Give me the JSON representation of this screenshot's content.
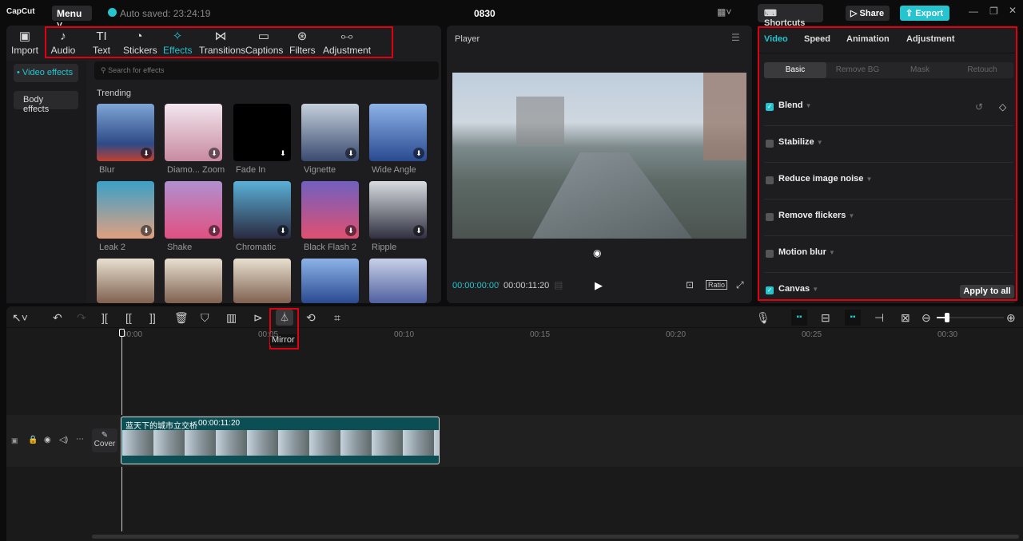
{
  "app": {
    "logo": "CapCut",
    "menu": "Menu",
    "autosave": "Auto saved: 23:24:19",
    "project": "0830",
    "shortcuts": "Shortcuts",
    "share": "Share",
    "export": "Export",
    "accent": "#25c4cf"
  },
  "tabs": [
    {
      "label": "Import",
      "icon": "import-icon"
    },
    {
      "label": "Audio",
      "icon": "audio-icon"
    },
    {
      "label": "Text",
      "icon": "text-icon"
    },
    {
      "label": "Stickers",
      "icon": "stickers-icon"
    },
    {
      "label": "Effects",
      "icon": "effects-icon"
    },
    {
      "label": "Transitions",
      "icon": "transitions-icon"
    },
    {
      "label": "Captions",
      "icon": "captions-icon"
    },
    {
      "label": "Filters",
      "icon": "filters-icon"
    },
    {
      "label": "Adjustment",
      "icon": "adjustment-icon"
    }
  ],
  "sidebar": [
    "Video effects",
    "Body effects"
  ],
  "search": {
    "placeholder": "Search for effects"
  },
  "section": "Trending",
  "effects": [
    "Blur",
    "Diamo... Zoom",
    "Fade In",
    "Vignette",
    "Wide Angle",
    "Leak 2",
    "Shake",
    "Chromatic",
    "Black Flash 2",
    "Ripple"
  ],
  "player": {
    "title": "Player",
    "current": "00:00:00:00",
    "total": "00:00:11:20",
    "ratio": "Ratio"
  },
  "right": {
    "tabs": [
      "Video",
      "Speed",
      "Animation",
      "Adjustment"
    ],
    "subtabs": [
      "Basic",
      "Remove BG",
      "Mask",
      "Retouch"
    ],
    "options": [
      {
        "label": "Blend",
        "checked": true
      },
      {
        "label": "Stabilize",
        "checked": false
      },
      {
        "label": "Reduce image noise",
        "checked": false
      },
      {
        "label": "Remove flickers",
        "checked": false
      },
      {
        "label": "Motion blur",
        "checked": false
      },
      {
        "label": "Canvas",
        "checked": true
      }
    ],
    "apply_all": "Apply to all"
  },
  "timeline": {
    "tooltip": "Mirror",
    "ticks": [
      "00:00",
      "00:05",
      "00:10",
      "00:15",
      "00:20",
      "00:25",
      "00:30"
    ],
    "cover": "Cover",
    "clip_name": "蓝天下的城市立交桥",
    "clip_duration": "00:00:11:20"
  }
}
